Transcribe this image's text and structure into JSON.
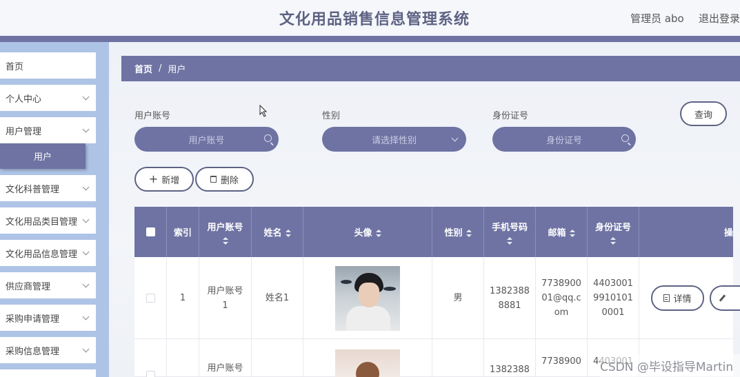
{
  "header": {
    "title": "文化用品销售信息管理系统",
    "user": "管理员 abo",
    "logout": "退出登录"
  },
  "sidebar": {
    "items": [
      {
        "label": "首页",
        "has_children": false
      },
      {
        "label": "个人中心",
        "has_children": true
      },
      {
        "label": "用户管理",
        "has_children": true
      },
      {
        "label": "文化科普管理",
        "has_children": true
      },
      {
        "label": "文化用品类目管理",
        "has_children": true
      },
      {
        "label": "文化用品信息管理",
        "has_children": true
      },
      {
        "label": "供应商管理",
        "has_children": true
      },
      {
        "label": "采购申请管理",
        "has_children": true
      },
      {
        "label": "采购信息管理",
        "has_children": true
      }
    ],
    "active_sub": "用户"
  },
  "breadcrumb": {
    "home": "首页",
    "separator": "/",
    "current": "用户"
  },
  "search": {
    "account_label": "用户账号",
    "account_placeholder": "用户账号",
    "gender_label": "性别",
    "gender_placeholder": "请选择性别",
    "idcard_label": "身份证号",
    "idcard_placeholder": "身份证号",
    "query_button": "查询"
  },
  "actions": {
    "add": "新增",
    "delete": "删除",
    "add_icon": "plus-icon",
    "delete_icon": "trash-icon"
  },
  "table": {
    "headers": [
      "索引",
      "用户账号",
      "姓名",
      "头像",
      "性别",
      "手机号码",
      "邮箱",
      "身份证号",
      "操"
    ],
    "rows": [
      {
        "index": "1",
        "account": "用户账号1",
        "name": "姓名1",
        "gender": "男",
        "phone": "13823888881",
        "email": "773890001@qq.com",
        "idcard": "440300199101010001",
        "detail": "详情"
      },
      {
        "index": "",
        "account": "用户账号",
        "name": "",
        "gender": "",
        "phone": "1382388",
        "email": "7738900",
        "idcard": "4403001",
        "detail": ""
      }
    ]
  },
  "watermark": "CSDN @毕设指导Martin",
  "colors": {
    "primary": "#6e73a3",
    "sidebar_bg": "#aec4e6",
    "title": "#5d6283"
  }
}
